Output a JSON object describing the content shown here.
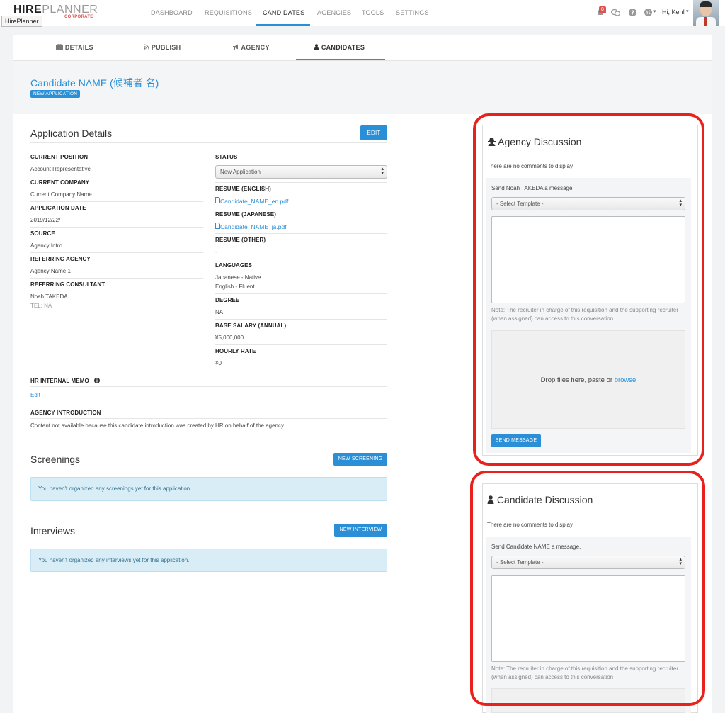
{
  "app": {
    "logo_hire": "HIRE",
    "logo_planner": "PLANNER",
    "logo_sub": "CORPORATE",
    "tooltip": "HirePlanner"
  },
  "nav": {
    "items": [
      "DASHBOARD",
      "REQUISITIONS",
      "CANDIDATES",
      "AGENCIES",
      "TOOLS",
      "SETTINGS"
    ],
    "active": "CANDIDATES",
    "notification_count": "8",
    "greeting": "Hi, Ken!"
  },
  "tabs": {
    "items": [
      "DETAILS",
      "PUBLISH",
      "AGENCY",
      "CANDIDATES"
    ],
    "active": "CANDIDATES"
  },
  "candidate": {
    "name": "Candidate NAME (候補者 名)",
    "badge": "NEW APPLICATION"
  },
  "application": {
    "title": "Application Details",
    "edit_label": "EDIT",
    "current_position_label": "CURRENT POSITION",
    "current_position": "Account Representative",
    "current_company_label": "CURRENT COMPANY",
    "current_company": "Current Company Name",
    "application_date_label": "APPLICATION DATE",
    "application_date": "2019/12/22/",
    "source_label": "SOURCE",
    "source": "Agency Intro",
    "referring_agency_label": "REFERRING AGENCY",
    "referring_agency": "Agency Name 1",
    "referring_consultant_label": "REFERRING CONSULTANT",
    "referring_consultant": "Noah TAKEDA",
    "consultant_tel": "TEL: NA",
    "status_label": "STATUS",
    "status_value": "New Application",
    "resume_en_label": "RESUME (ENGLISH)",
    "resume_en": "Candidate_NAME_en.pdf",
    "resume_ja_label": "RESUME (JAPANESE)",
    "resume_ja": "Candidate_NAME_ja.pdf",
    "resume_other_label": "RESUME (OTHER)",
    "resume_other": "-",
    "languages_label": "LANGUAGES",
    "language_1": "Japanese - Native",
    "language_2": "English - Fluent",
    "degree_label": "DEGREE",
    "degree": "NA",
    "base_salary_label": "BASE SALARY (ANNUAL)",
    "base_salary": "¥5,000,000",
    "hourly_rate_label": "HOURLY RATE",
    "hourly_rate": "¥0",
    "hr_memo_label": "HR INTERNAL MEMO",
    "hr_memo_edit": "Edit",
    "agency_intro_label": "AGENCY INTRODUCTION",
    "agency_intro": "Content not available because this candidate introduction was created by HR on behalf of the agency"
  },
  "screenings": {
    "title": "Screenings",
    "button": "NEW SCREENING",
    "empty": "You haven't organized any screenings yet for this application."
  },
  "interviews": {
    "title": "Interviews",
    "button": "NEW INTERVIEW",
    "empty": "You haven't organized any interviews yet for this application."
  },
  "agency_discussion": {
    "title": "Agency Discussion",
    "empty": "There are no comments to display",
    "send_to": "Send Noah TAKEDA a message.",
    "template_placeholder": "- Select Template -",
    "note": "Note: The recruiter in charge of this requisition and the supporting recruiter (when assigned) can access to this conversation",
    "drop_text": "Drop files here, paste or",
    "browse": "browse",
    "send_button": "SEND MESSAGE"
  },
  "candidate_discussion": {
    "title": "Candidate Discussion",
    "empty": "There are no comments to display",
    "send_to": "Send Candidate NAME a message.",
    "template_placeholder": "- Select Template -",
    "note": "Note: The recruiter in charge of this requisition and the supporting recruiter (when assigned) can access to this conversation"
  },
  "colors": {
    "accent": "#2a8fd6",
    "highlight": "#e8211d",
    "badge": "#d9534f"
  }
}
